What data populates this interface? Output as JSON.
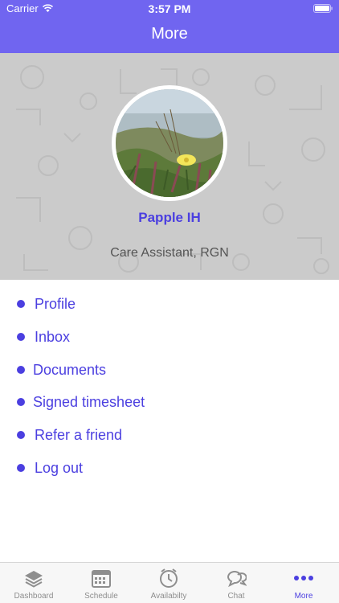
{
  "status_bar": {
    "carrier": "Carrier",
    "time": "3:57 PM"
  },
  "header": {
    "title": "More"
  },
  "profile": {
    "name": "Papple IH",
    "role": "Care Assistant, RGN"
  },
  "menu": {
    "items": [
      {
        "label": "Profile"
      },
      {
        "label": "Inbox"
      },
      {
        "label": "Documents"
      },
      {
        "label": "Signed timesheet"
      },
      {
        "label": "Refer a friend"
      },
      {
        "label": "Log out"
      }
    ]
  },
  "tabbar": {
    "items": [
      {
        "label": "Dashboard",
        "icon": "layers-icon"
      },
      {
        "label": "Schedule",
        "icon": "calendar-icon"
      },
      {
        "label": "Availabilty",
        "icon": "clock-icon"
      },
      {
        "label": "Chat",
        "icon": "chat-icon"
      },
      {
        "label": "More",
        "icon": "more-icon"
      }
    ],
    "active": "More"
  },
  "colors": {
    "header": "#7065f0",
    "accent": "#4b3fe0",
    "banner": "#cbcbcb"
  }
}
